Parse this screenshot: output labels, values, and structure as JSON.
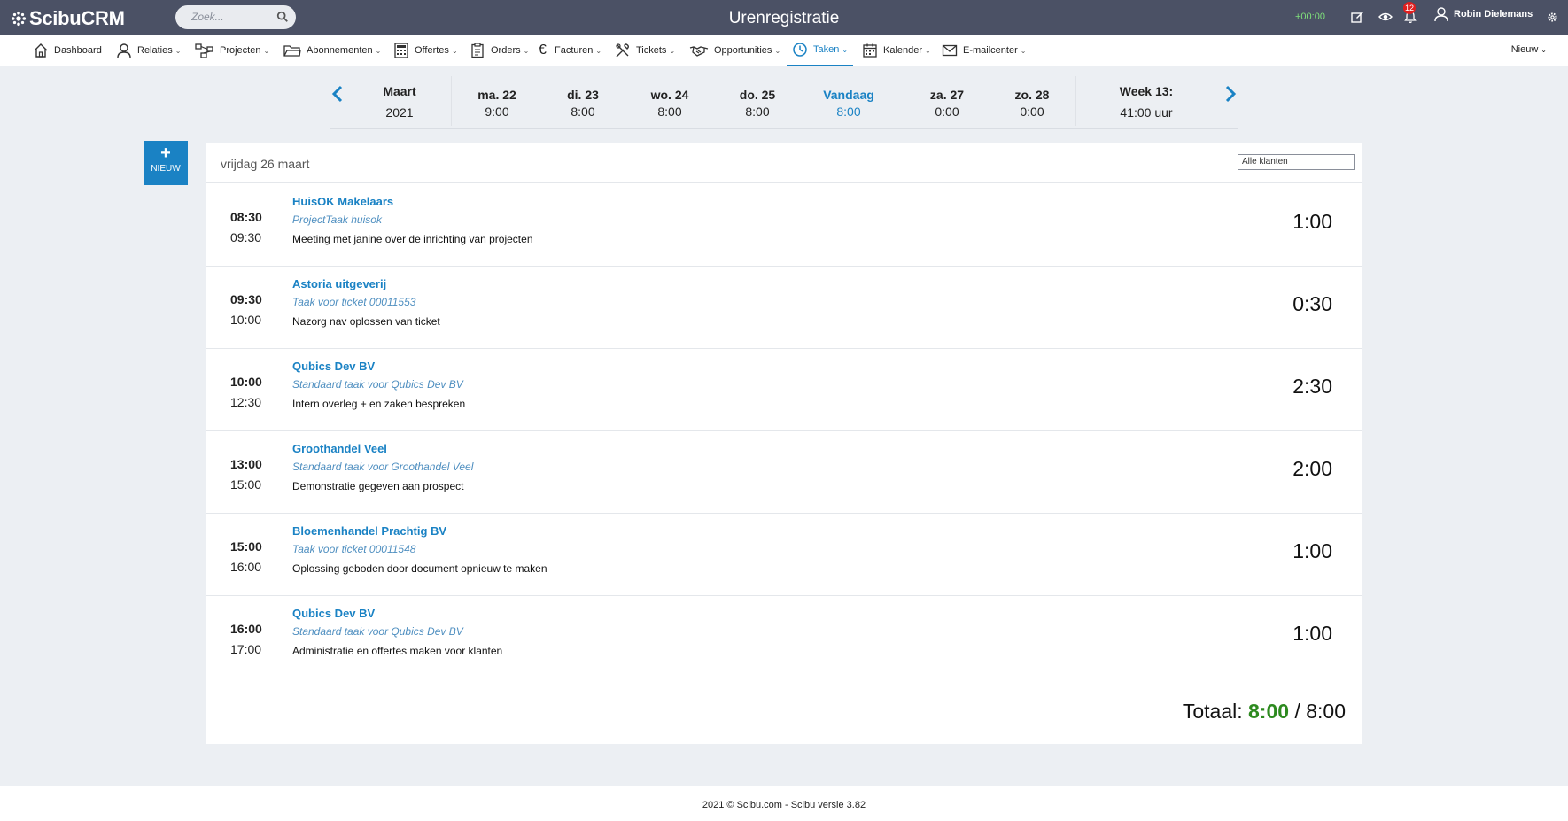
{
  "app": {
    "logo": "ScibuCRM",
    "title": "Urenregistratie",
    "search_placeholder": "Zoek...",
    "timer": "+00:00",
    "notifications_count": "12",
    "user_name": "Robin Dielemans"
  },
  "nav": {
    "items": [
      {
        "label": "Dashboard",
        "icon": "home-icon"
      },
      {
        "label": "Relaties",
        "icon": "person-icon"
      },
      {
        "label": "Projecten",
        "icon": "project-icon"
      },
      {
        "label": "Abonnementen",
        "icon": "folder-icon"
      },
      {
        "label": "Offertes",
        "icon": "calculator-icon"
      },
      {
        "label": "Orders",
        "icon": "clipboard-icon"
      },
      {
        "label": "Facturen",
        "icon": "euro-icon"
      },
      {
        "label": "Tickets",
        "icon": "tools-icon"
      },
      {
        "label": "Opportunities",
        "icon": "handshake-icon"
      },
      {
        "label": "Taken",
        "icon": "clock-icon"
      },
      {
        "label": "Kalender",
        "icon": "calendar-icon"
      },
      {
        "label": "E-mailcenter",
        "icon": "mail-icon"
      }
    ],
    "new_label": "Nieuw"
  },
  "week": {
    "month": "Maart",
    "year": "2021",
    "days": [
      {
        "label": "ma. 22",
        "hours": "9:00"
      },
      {
        "label": "di. 23",
        "hours": "8:00"
      },
      {
        "label": "wo. 24",
        "hours": "8:00"
      },
      {
        "label": "do. 25",
        "hours": "8:00"
      },
      {
        "label": "Vandaag",
        "hours": "8:00"
      },
      {
        "label": "za. 27",
        "hours": "0:00"
      },
      {
        "label": "zo. 28",
        "hours": "0:00"
      }
    ],
    "week_label": "Week 13:",
    "week_total": "41:00 uur"
  },
  "new_button": {
    "label": "NIEUW"
  },
  "day": {
    "title": "vrijdag 26 maart",
    "filter": "Alle klanten",
    "entries": [
      {
        "start": "08:30",
        "end": "09:30",
        "client": "HuisOK Makelaars",
        "task": "ProjectTaak huisok",
        "description": "Meeting met janine over de inrichting van projecten",
        "duration": "1:00"
      },
      {
        "start": "09:30",
        "end": "10:00",
        "client": "Astoria uitgeverij",
        "task": "Taak voor ticket 00011553",
        "description": "Nazorg nav oplossen van ticket",
        "duration": "0:30"
      },
      {
        "start": "10:00",
        "end": "12:30",
        "client": "Qubics Dev BV",
        "task": "Standaard taak voor Qubics Dev BV",
        "description": "Intern overleg + en zaken bespreken",
        "duration": "2:30"
      },
      {
        "start": "13:00",
        "end": "15:00",
        "client": "Groothandel Veel",
        "task": "Standaard taak voor Groothandel Veel",
        "description": "Demonstratie gegeven aan prospect",
        "duration": "2:00"
      },
      {
        "start": "15:00",
        "end": "16:00",
        "client": "Bloemenhandel Prachtig BV",
        "task": "Taak voor ticket 00011548",
        "description": "Oplossing geboden door document opnieuw te maken",
        "duration": "1:00"
      },
      {
        "start": "16:00",
        "end": "17:00",
        "client": "Qubics Dev BV",
        "task": "Standaard taak voor Qubics Dev BV",
        "description": "Administratie en offertes maken voor klanten",
        "duration": "1:00"
      }
    ],
    "total_label": "Totaal:",
    "total_value": "8:00",
    "total_separator": "/",
    "total_target": "8:00"
  },
  "footer": {
    "text": "2021 © Scibu.com - Scibu versie 3.82"
  },
  "colors": {
    "accent": "#1a82c4",
    "topbar": "#4b5165",
    "total_green": "#2d8a1f",
    "timer_green": "#7fe07b",
    "badge_red": "#e01e1e"
  }
}
